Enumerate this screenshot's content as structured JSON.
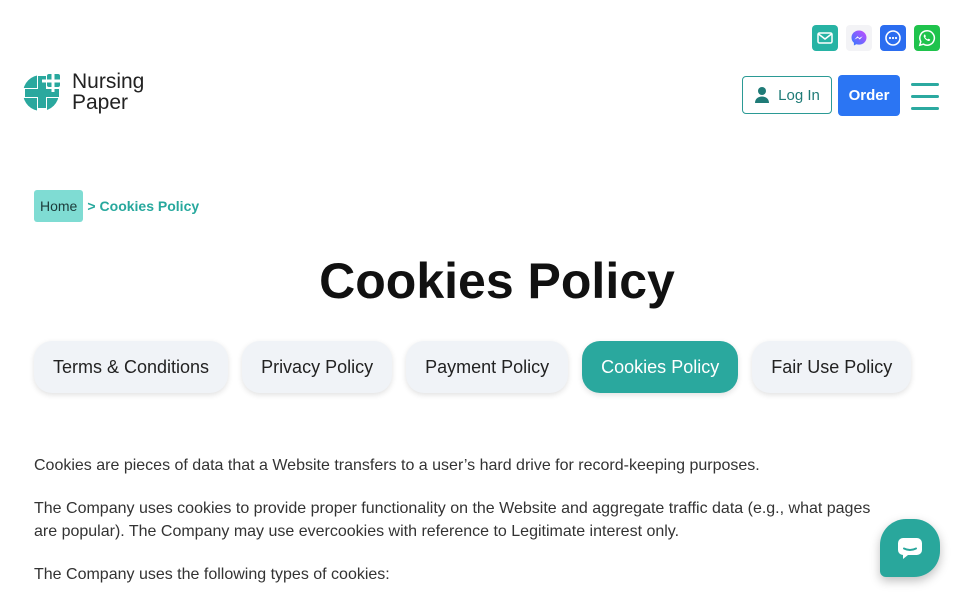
{
  "contacts": [
    {
      "name": "email-icon"
    },
    {
      "name": "messenger-icon"
    },
    {
      "name": "chat-icon"
    },
    {
      "name": "whatsapp-icon"
    }
  ],
  "logo": {
    "line1": "Nursing",
    "line2": "Paper"
  },
  "header": {
    "login_label": "Log In",
    "order_label": "Order"
  },
  "breadcrumb": {
    "home": "Home",
    "separator": ">",
    "current": "Cookies Policy"
  },
  "page_title": "Cookies Policy",
  "tabs": [
    {
      "label": "Terms & Conditions",
      "active": false
    },
    {
      "label": "Privacy Policy",
      "active": false
    },
    {
      "label": "Payment Policy",
      "active": false
    },
    {
      "label": "Cookies Policy",
      "active": true
    },
    {
      "label": "Fair Use Policy",
      "active": false
    }
  ],
  "content": {
    "paragraphs": [
      "Cookies are pieces of data that a Website transfers to a user’s hard drive for record-keeping purposes.",
      "The Company uses cookies to provide proper functionality on the Website and aggregate traffic data (e.g., what pages are popular). The Company may use evercookies with reference to Legitimate interest only.",
      "The Company uses the following types of cookies:"
    ]
  },
  "colors": {
    "accent": "#2aa89e",
    "order": "#2b75f3"
  }
}
